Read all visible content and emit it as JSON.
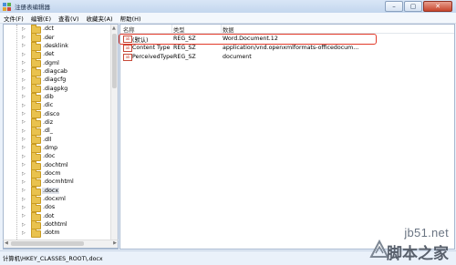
{
  "window": {
    "title": "注册表编辑器",
    "controls": {
      "minimize": "–",
      "maximize": "▢",
      "close": "✕"
    }
  },
  "menu": [
    "文件(F)",
    "编辑(E)",
    "查看(V)",
    "收藏夹(A)",
    "帮助(H)"
  ],
  "tree": {
    "items": [
      {
        "label": ".dct"
      },
      {
        "label": ".der"
      },
      {
        "label": ".desklink"
      },
      {
        "label": ".det"
      },
      {
        "label": ".dgml"
      },
      {
        "label": ".diagcab"
      },
      {
        "label": ".diagcfg"
      },
      {
        "label": ".diagpkg"
      },
      {
        "label": ".dib"
      },
      {
        "label": ".dic"
      },
      {
        "label": ".disco"
      },
      {
        "label": ".diz"
      },
      {
        "label": ".dl_"
      },
      {
        "label": ".dll"
      },
      {
        "label": ".dmp"
      },
      {
        "label": ".doc"
      },
      {
        "label": ".dochtml"
      },
      {
        "label": ".docm"
      },
      {
        "label": ".docmhtml"
      },
      {
        "label": ".docx",
        "selected": true
      },
      {
        "label": ".docxml"
      },
      {
        "label": ".dos"
      },
      {
        "label": ".dot"
      },
      {
        "label": ".dothtml"
      },
      {
        "label": ".dotm"
      }
    ]
  },
  "values": {
    "columns": [
      "名称",
      "类型",
      "数据"
    ],
    "rows": [
      {
        "name": "(默认)",
        "type": "REG_SZ",
        "data": "Word.Document.12",
        "highlighted": true
      },
      {
        "name": "Content Type",
        "type": "REG_SZ",
        "data": "application/vnd.openxmlformats-officedocum..."
      },
      {
        "name": "PerceivedType",
        "type": "REG_SZ",
        "data": "document"
      }
    ],
    "icon_text": "ab"
  },
  "status": {
    "path": "计算机\\HKEY_CLASSES_ROOT\\.docx"
  },
  "watermark": {
    "site": "jb51.net",
    "brand": "脚本之家"
  },
  "colors": {
    "highlight_border": "#e23a2a",
    "folder": "#e9c24e",
    "titlebar": "#c3d6ee"
  }
}
